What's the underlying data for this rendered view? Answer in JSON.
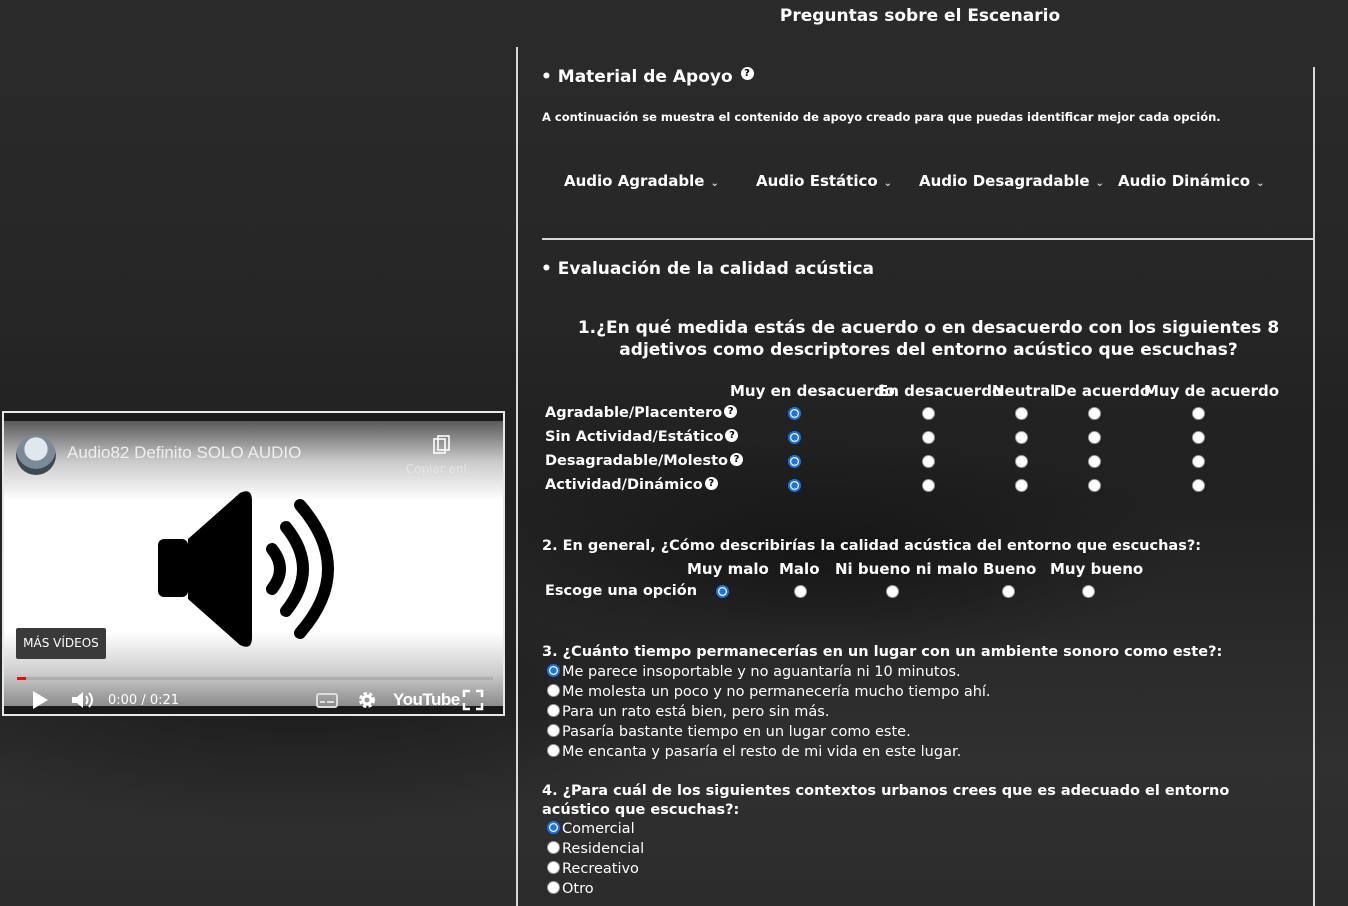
{
  "page": {
    "title": "Preguntas sobre el Escenario"
  },
  "material": {
    "title": "• Material de Apoyo",
    "intro": "A continuación se muestra el contenido de apoyo creado para que puedas identificar mejor cada opción.",
    "dropdowns": [
      "Audio Agradable",
      "Audio Estático",
      "Audio Desagradable",
      "Audio Dinámico"
    ]
  },
  "evaluation": {
    "title": "• Evaluación de la calidad acústica"
  },
  "q1": {
    "text": "1.¿En qué medida estás de acuerdo o en desacuerdo con los siguientes 8 adjetivos como descriptores del entorno acústico que escuchas?",
    "columns": [
      "Muy en desacuerdo",
      "En desacuerdo",
      "Neutral",
      "De acuerdo",
      "Muy de acuerdo"
    ],
    "rows": [
      "Agradable/Placentero",
      "Sin Actividad/Estático",
      "Desagradable/Molesto",
      "Actividad/Dinámico"
    ],
    "selected_column": "Muy en desacuerdo"
  },
  "q2": {
    "text": "2. En general, ¿Cómo describirías la calidad acústica del entorno que escuchas?:",
    "row_label": "Escoge una opción",
    "columns": [
      "Muy malo",
      "Malo",
      "Ni bueno ni malo",
      "Bueno",
      "Muy bueno"
    ],
    "selected": "Muy malo"
  },
  "q3": {
    "text": "3. ¿Cuánto tiempo permanecerías en un lugar con un ambiente sonoro como este?:",
    "options": [
      "Me parece insoportable y no aguantaría ni 10 minutos.",
      "Me molesta un poco y no permanecería mucho tiempo ahí.",
      "Para un rato está bien, pero sin más.",
      "Pasaría bastante tiempo en un lugar como este.",
      "Me encanta y pasaría el resto de mi vida en este lugar."
    ],
    "selected": "Me parece insoportable y no aguantaría ni 10 minutos."
  },
  "q4": {
    "text": "4. ¿Para cuál de los siguientes contextos urbanos crees que es adecuado el entorno acústico que escuchas?:",
    "options": [
      "Comercial",
      "Residencial",
      "Recreativo",
      "Otro"
    ],
    "selected": "Comercial"
  },
  "video": {
    "title": "Audio82 Definito SOLO AUDIO",
    "copy_label": "Copiar enl...",
    "more_videos": "MÁS VÍDEOS",
    "time": "0:00 / 0:21",
    "progress_fraction": 0.0,
    "logo_text": "YouTube",
    "icons": [
      "play-icon",
      "volume-icon",
      "subtitles-icon",
      "gear-icon",
      "fullscreen-icon",
      "copy-link-icon",
      "speaker-icon"
    ]
  }
}
